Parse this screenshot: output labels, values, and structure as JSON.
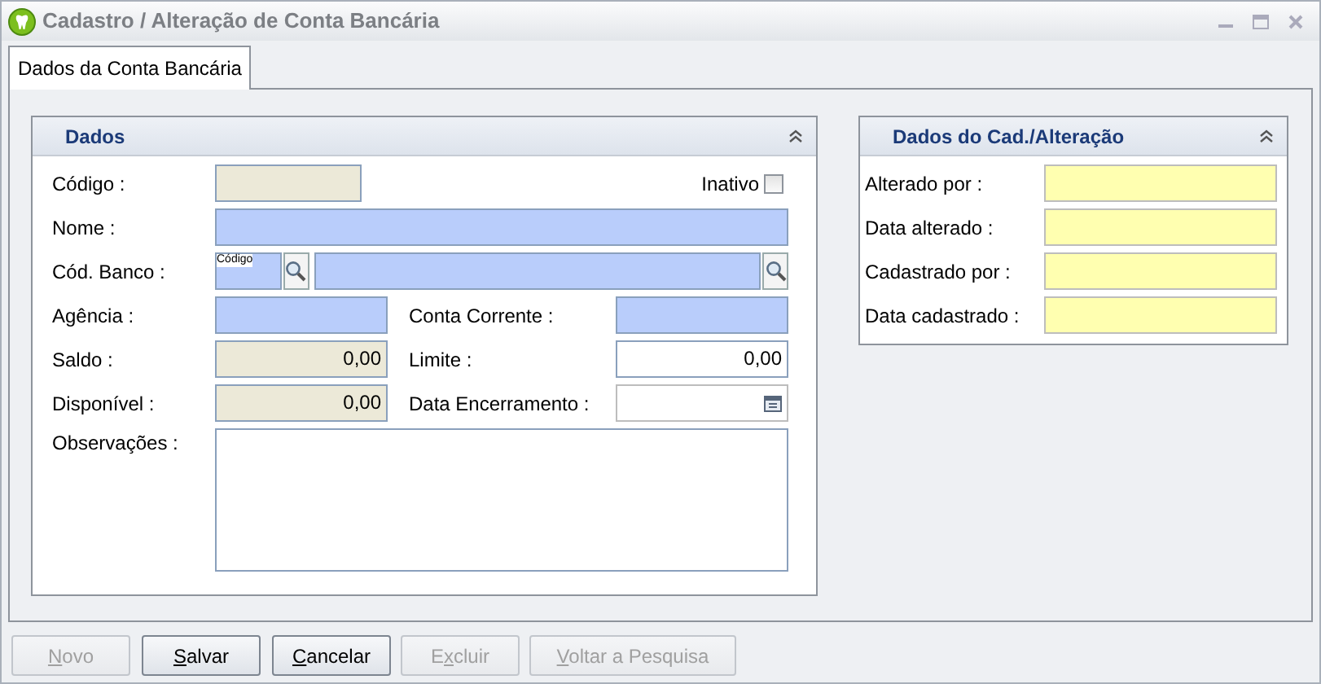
{
  "window": {
    "title": "Cadastro / Alteração de Conta Bancária"
  },
  "tabs": [
    {
      "label": "Dados da Conta Bancária",
      "selected": true
    }
  ],
  "dados": {
    "title": "Dados",
    "inativo": {
      "label": "Inativo",
      "checked": false
    },
    "codigo": {
      "label": "Código :",
      "kind": "readonly"
    },
    "nome": {
      "label": "Nome :",
      "kind": "required"
    },
    "cod_banco": {
      "label": "Cód. Banco :",
      "caption": "Código",
      "kind": "required"
    },
    "agencia": {
      "label": "Agência :",
      "kind": "required"
    },
    "conta_corrente": {
      "label": "Conta Corrente :",
      "kind": "required"
    },
    "saldo": {
      "label": "Saldo :",
      "value": "0,00",
      "kind": "readonly"
    },
    "limite": {
      "label": "Limite :",
      "value": "0,00",
      "kind": "plain"
    },
    "disponivel": {
      "label": "Disponível :",
      "value": "0,00",
      "kind": "readonly"
    },
    "data_encerramento": {
      "label": "Data Encerramento :",
      "kind": "date"
    },
    "observacoes": {
      "label": "Observações :",
      "kind": "plain"
    }
  },
  "audit": {
    "title": "Dados do Cad./Alteração",
    "fields": [
      {
        "label": "Alterado por :"
      },
      {
        "label": "Data alterado :"
      },
      {
        "label": "Cadastrado por :"
      },
      {
        "label": "Data cadastrado :"
      }
    ]
  },
  "buttons": [
    {
      "access_key": "N",
      "rest": "ovo",
      "disabled": true
    },
    {
      "access_key": "S",
      "rest": "alvar",
      "disabled": false
    },
    {
      "access_key": "C",
      "rest": "ancelar",
      "disabled": false
    },
    {
      "prefix": "E",
      "access_key": "x",
      "rest": "cluir",
      "disabled": true
    },
    {
      "access_key": "V",
      "rest": "oltar a Pesquisa",
      "disabled": true
    }
  ]
}
